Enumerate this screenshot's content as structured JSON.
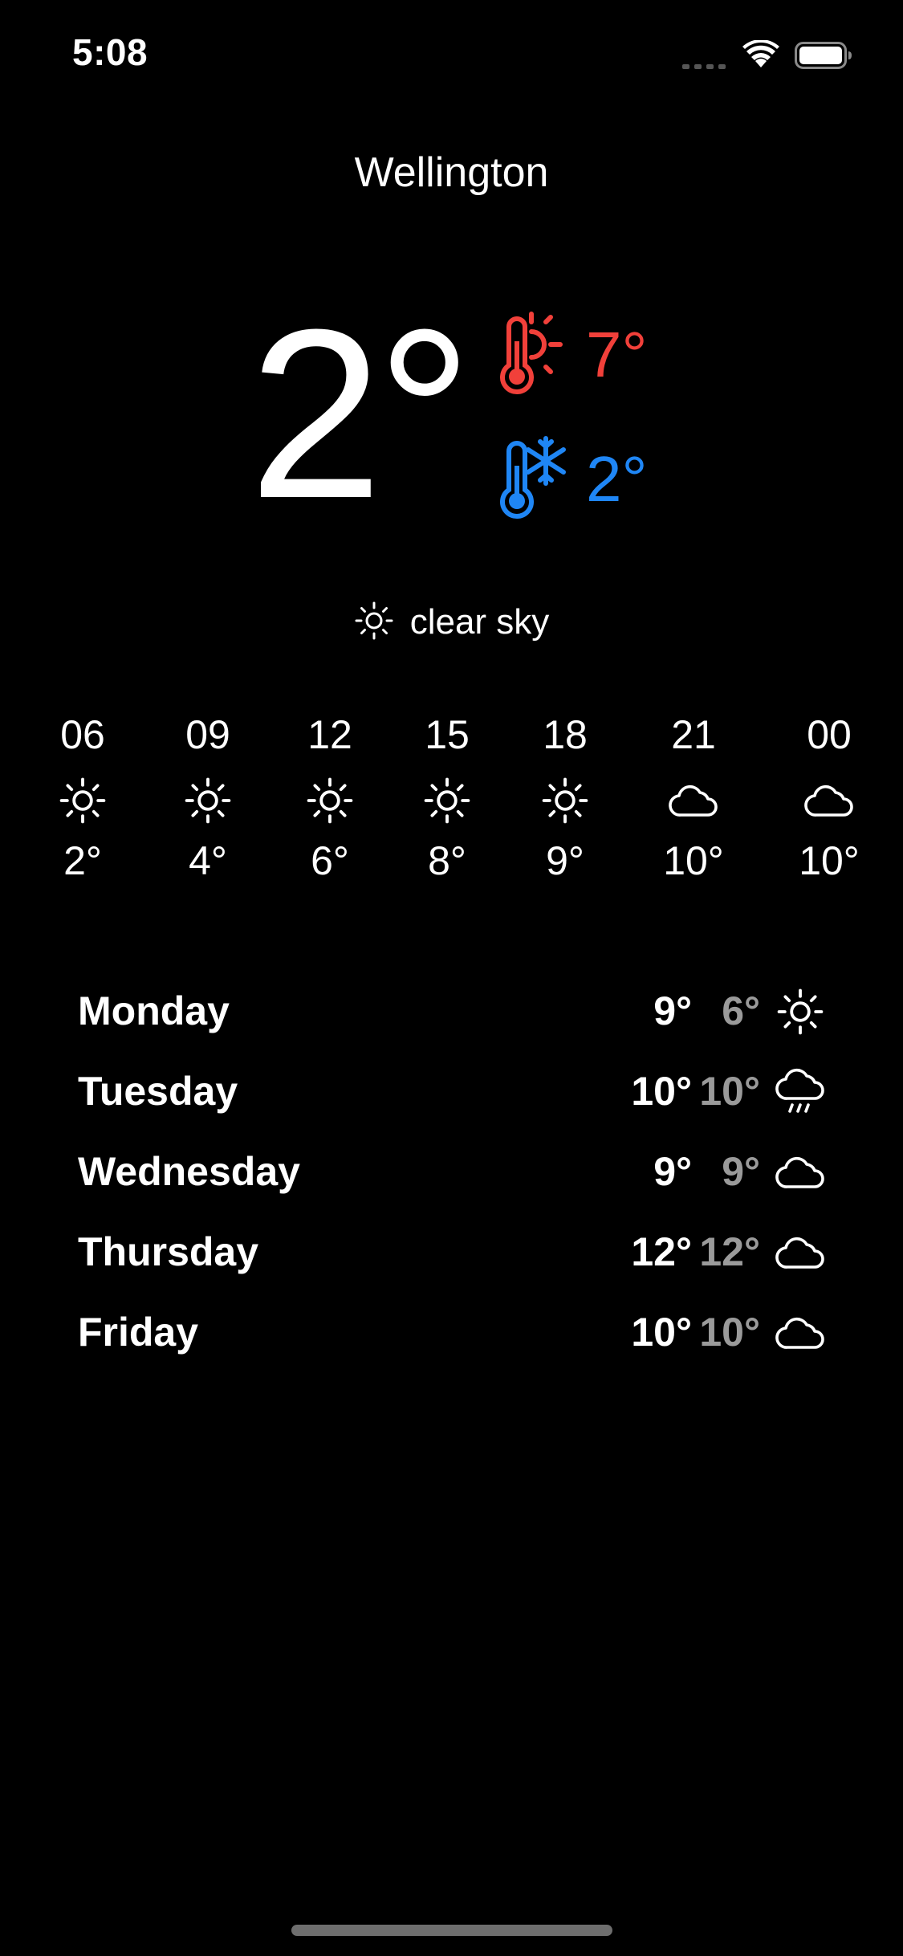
{
  "status_bar": {
    "time": "5:08",
    "icons": [
      "cellular-signal-icon",
      "wifi-icon",
      "battery-icon"
    ]
  },
  "location": {
    "city": "Wellington"
  },
  "current": {
    "temperature": "2°",
    "high": "7°",
    "low": "2°",
    "condition": "clear sky",
    "condition_icon": "sun-icon",
    "colors": {
      "high": "#f1403a",
      "low": "#1f86f5"
    }
  },
  "hourly": [
    {
      "time": "06",
      "icon": "sun-icon",
      "temp": "2°"
    },
    {
      "time": "09",
      "icon": "sun-icon",
      "temp": "4°"
    },
    {
      "time": "12",
      "icon": "sun-icon",
      "temp": "6°"
    },
    {
      "time": "15",
      "icon": "sun-icon",
      "temp": "8°"
    },
    {
      "time": "18",
      "icon": "sun-icon",
      "temp": "9°"
    },
    {
      "time": "21",
      "icon": "cloud-icon",
      "temp": "10°"
    },
    {
      "time": "00",
      "icon": "cloud-icon",
      "temp": "10°"
    }
  ],
  "daily": [
    {
      "day": "Monday",
      "high": "9°",
      "low": "6°",
      "icon": "sun-icon"
    },
    {
      "day": "Tuesday",
      "high": "10°",
      "low": "10°",
      "icon": "cloud-rain-icon"
    },
    {
      "day": "Wednesday",
      "high": "9°",
      "low": "9°",
      "icon": "cloud-icon"
    },
    {
      "day": "Thursday",
      "high": "12°",
      "low": "12°",
      "icon": "cloud-icon"
    },
    {
      "day": "Friday",
      "high": "10°",
      "low": "10°",
      "icon": "cloud-icon"
    }
  ]
}
